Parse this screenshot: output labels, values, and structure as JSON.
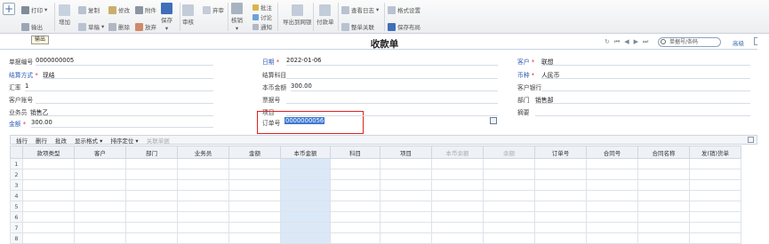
{
  "toolbar": {
    "print": "打印",
    "output": "输出",
    "add": "增加",
    "copy": "复制",
    "modify": "修改",
    "attach": "附件",
    "draft": "草稿",
    "delete": "删除",
    "abandon": "放弃",
    "save": "保存",
    "audit": "审核",
    "unaudit": "弃审",
    "verify": "核销",
    "annotate": "批注",
    "discuss": "讨论",
    "notify": "通知",
    "export_pair": "导出到网银",
    "paydraft": "付款单",
    "view_log": "查看日志",
    "whole_link": "整单关联",
    "format_settings": "格式设置",
    "save_layout": "保存布局"
  },
  "tooltip": "输出",
  "title": "收款单",
  "search": {
    "placeholder": "单据号/条码"
  },
  "advanced": "高级",
  "form": {
    "doc_no_label": "单据编号",
    "doc_no": "0000000005",
    "date_label": "日期",
    "date": "2022-01-06",
    "customer_label": "客户",
    "customer": "联想",
    "settle_label": "结算方式",
    "settle": "现结",
    "settle_subject_label": "结算科目",
    "currency_label": "币种",
    "currency": "人民币",
    "rate_label": "汇率",
    "rate": "1",
    "local_amount_label": "本币金额",
    "local_amount": "300.00",
    "cust_bank_label": "客户银行",
    "cust_account_label": "客户账号",
    "bill_no_label": "票据号",
    "dept_label": "部门",
    "dept": "销售部",
    "salesman_label": "业务员",
    "salesman": "销售乙",
    "project_label": "项目",
    "summary_label": "摘要",
    "amount_label": "金额",
    "amount": "300.00",
    "order_no_label": "订单号",
    "order_no": "0000000056"
  },
  "grid": {
    "bar": [
      "插行",
      "删行",
      "批改",
      "显示格式",
      "排序定位",
      "关联单据"
    ],
    "columns": [
      "",
      "款项类型",
      "客户",
      "部门",
      "业务员",
      "金额",
      "本币金额",
      "科目",
      "项目",
      "本币余额",
      "余额",
      "订单号",
      "合同号",
      "合同名称",
      "发(销)货单"
    ],
    "rows": [
      "1",
      "2",
      "3",
      "4",
      "5",
      "6",
      "7",
      "8"
    ]
  }
}
